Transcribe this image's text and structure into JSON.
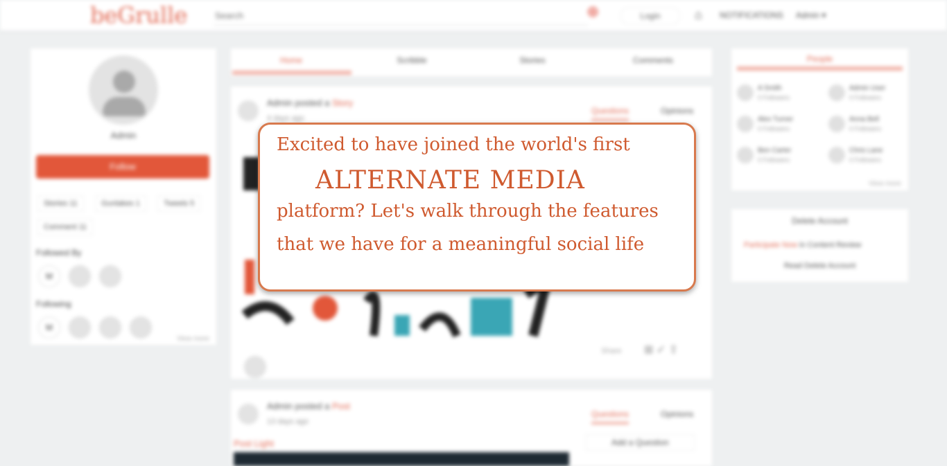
{
  "brand": {
    "logo": "beGrulle",
    "accent": "#e26a55"
  },
  "header": {
    "search_placeholder": "Search",
    "login": "Login",
    "notifications": "NOTIFICATIONS",
    "user": "Admin ▾"
  },
  "profile": {
    "name": "Admin",
    "follow": "Follow",
    "stats": [
      "Stories 11",
      "Gunlakes 1",
      "Tweets 5",
      "Comment 11"
    ],
    "followed_by": "Followed By",
    "following": "Following",
    "view_more": "View more"
  },
  "tabs": [
    "Home",
    "Scribble",
    "Stories",
    "Comments"
  ],
  "posts": [
    {
      "author": "Admin posted a",
      "kind": "Story",
      "time": "4 days ago",
      "tab_active": "Questions",
      "tab_other": "Opinions",
      "share": "Share"
    },
    {
      "author": "Admin posted a",
      "kind": "Post",
      "time": "13 days ago",
      "tab_active": "Questions",
      "tab_other": "Opinions",
      "label": "Post Light",
      "add_question": "Add a Question"
    }
  ],
  "people": {
    "title": "People",
    "items": [
      {
        "name": "A Smith",
        "followers": "0 Followers"
      },
      {
        "name": "Admin User",
        "followers": "0 Followers"
      },
      {
        "name": "Alex Turner",
        "followers": "0 Followers"
      },
      {
        "name": "Anna Bell",
        "followers": "0 Followers"
      },
      {
        "name": "Ben Carter",
        "followers": "0 Followers"
      },
      {
        "name": "Chris Lane",
        "followers": "0 Followers"
      }
    ],
    "view_more": "View more"
  },
  "account": {
    "title": "Delete Account",
    "line1_hl": "Participate Now",
    "line1_rest": "in Content Review",
    "line2": "Read Delete Account"
  },
  "overlay": {
    "line1": "Excited to have joined the world's first",
    "line2": "ALTERNATE  MEDIA",
    "line3": "platform? Let's walk through the features",
    "line4": "that we have for a meaningful social life"
  }
}
